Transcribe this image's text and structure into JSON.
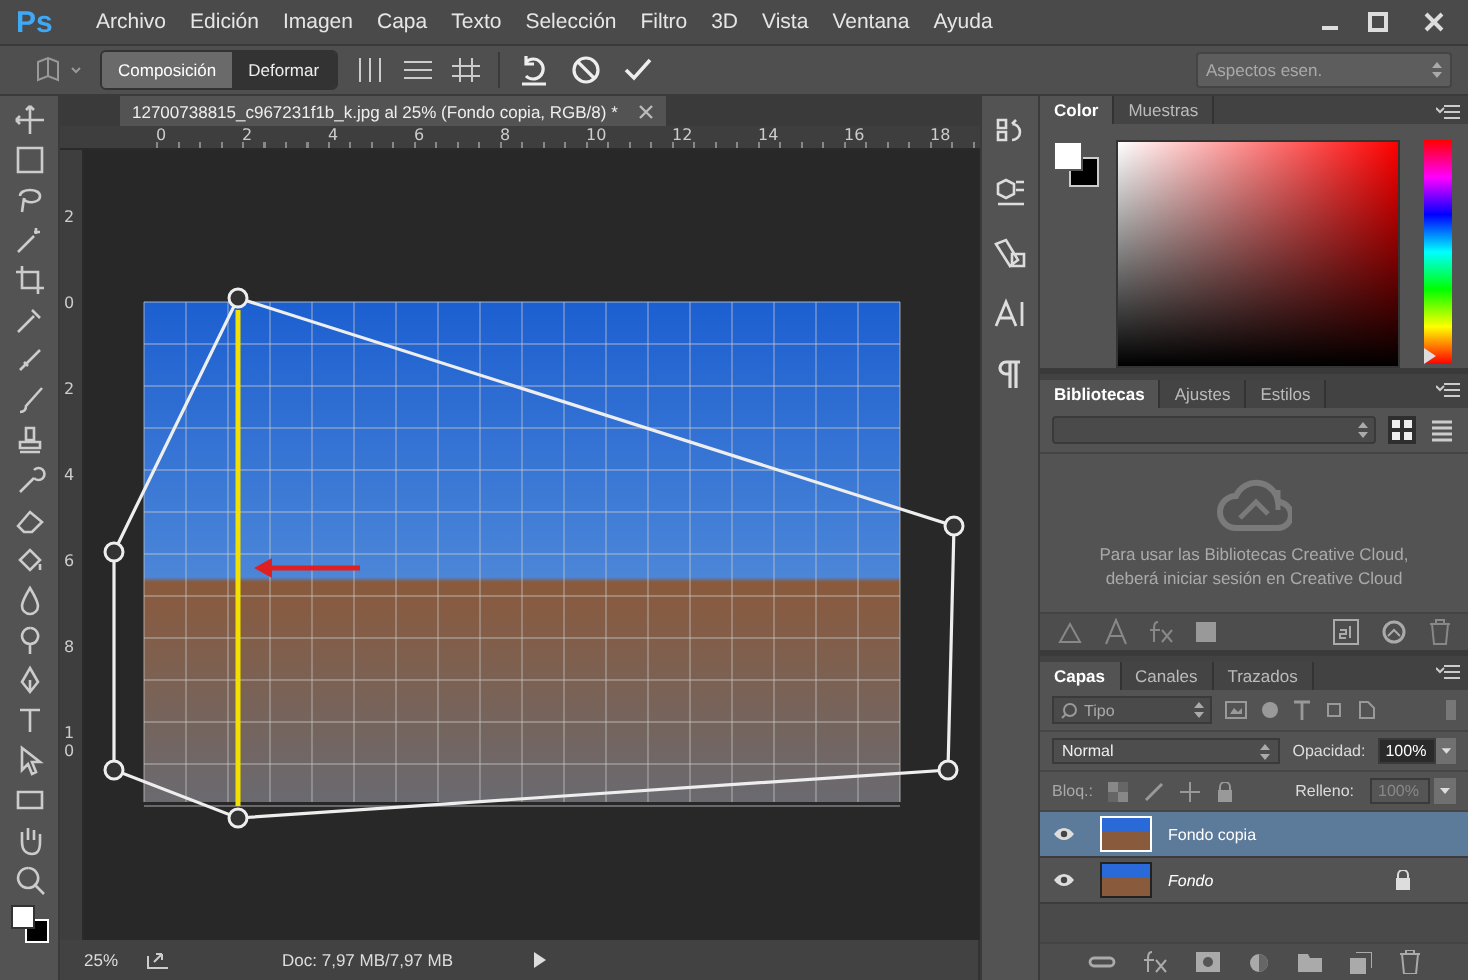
{
  "menu_bar": {
    "logo": "Ps",
    "items": [
      "Archivo",
      "Edición",
      "Imagen",
      "Capa",
      "Texto",
      "Selección",
      "Filtro",
      "3D",
      "Vista",
      "Ventana",
      "Ayuda"
    ]
  },
  "options_bar": {
    "modes": [
      {
        "label": "Composición",
        "selected": true
      },
      {
        "label": "Deformar",
        "selected": false
      }
    ],
    "workspace": "Aspectos esen."
  },
  "document": {
    "tab_title": "12700738815_c967231f1b_k.jpg al 25% (Fondo copia, RGB/8) *",
    "ruler_h": [
      "0",
      "2",
      "4",
      "6",
      "8",
      "10",
      "12",
      "14",
      "16",
      "18"
    ],
    "ruler_v": [
      "2",
      "0",
      "2",
      "4",
      "6",
      "8",
      "10"
    ]
  },
  "status_bar": {
    "zoom": "25%",
    "doc_size": "Doc: 7,97 MB/7,97 MB"
  },
  "color_panel": {
    "tabs": [
      {
        "label": "Color",
        "selected": true
      },
      {
        "label": "Muestras",
        "selected": false
      }
    ],
    "hue_slider": {
      "level": 0
    }
  },
  "libraries_panel": {
    "tabs": [
      {
        "label": "Bibliotecas",
        "selected": true
      },
      {
        "label": "Ajustes",
        "selected": false
      },
      {
        "label": "Estilos",
        "selected": false
      }
    ],
    "message": "Para usar las Bibliotecas Creative Cloud, deberá iniciar sesión en Creative Cloud"
  },
  "layers_panel": {
    "tabs": [
      {
        "label": "Capas",
        "selected": true
      },
      {
        "label": "Canales",
        "selected": false
      },
      {
        "label": "Trazados",
        "selected": false
      }
    ],
    "filter": "Tipo",
    "blend_mode": "Normal",
    "opacity_label": "Opacidad:",
    "opacity": "100%",
    "lock_label": "Bloq.:",
    "fill_label": "Relleno:",
    "fill": "100%",
    "fill_disabled": true,
    "layers": [
      {
        "name": "Fondo copia",
        "kind": "layer",
        "selected": true,
        "visible": true,
        "locked": false
      },
      {
        "name": "Fondo",
        "kind": "background",
        "selected": false,
        "visible": true,
        "locked": true
      }
    ]
  }
}
